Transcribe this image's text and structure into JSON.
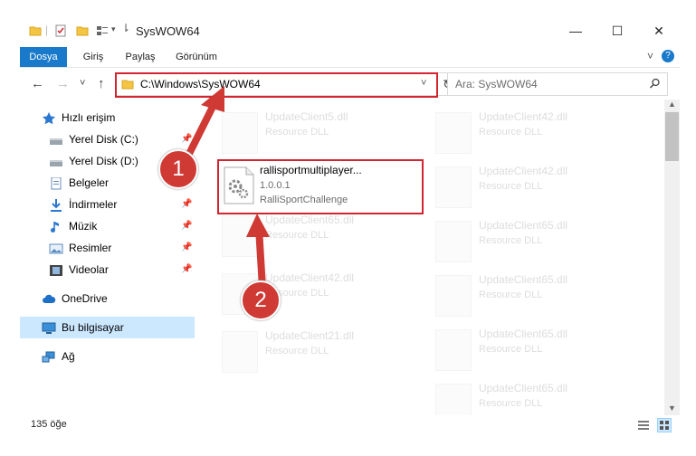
{
  "window": {
    "title": "SysWOW64",
    "minimize": "—",
    "maximize": "☐",
    "close": "✕"
  },
  "ribbon": {
    "tabs": [
      "Dosya",
      "Giriş",
      "Paylaş",
      "Görünüm"
    ],
    "expand": "˅",
    "help": "?"
  },
  "address": {
    "back": "←",
    "forward": "→",
    "recent": "˅",
    "up": "↑",
    "path": "C:\\Windows\\SysWOW64",
    "dropdown": "˅",
    "refresh": "↻",
    "search_placeholder": "Ara: SysWOW64",
    "search_icon": "magnifier-icon"
  },
  "sidebar": {
    "items": [
      {
        "label": "Hızlı erişim",
        "icon": "star-icon"
      },
      {
        "label": "Yerel Disk (C:)",
        "icon": "drive-icon",
        "pinned": true
      },
      {
        "label": "Yerel Disk (D:)",
        "icon": "drive-icon",
        "pinned": true
      },
      {
        "label": "Belgeler",
        "icon": "documents-icon",
        "pinned": true
      },
      {
        "label": "İndirmeler",
        "icon": "download-icon",
        "pinned": true
      },
      {
        "label": "Müzik",
        "icon": "music-icon",
        "pinned": true
      },
      {
        "label": "Resimler",
        "icon": "pictures-icon",
        "pinned": true
      },
      {
        "label": "Videolar",
        "icon": "video-icon",
        "pinned": true
      },
      {
        "label": "OneDrive",
        "icon": "cloud-icon"
      },
      {
        "label": "Bu bilgisayar",
        "icon": "computer-icon",
        "selected": true
      },
      {
        "label": "Ağ",
        "icon": "network-icon"
      }
    ],
    "pin_glyph": "📌"
  },
  "files": {
    "left_column": [
      {
        "name": "UpdateClient5.dll",
        "desc": "Resource DLL"
      },
      {
        "name": "UpdateClient65.dll",
        "desc": "Resource DLL"
      },
      {
        "name": "UpdateClient42.dll",
        "desc": "Resource DLL"
      },
      {
        "name": "UpdateClient21.dll",
        "desc": "Resource DLL"
      }
    ],
    "right_column": [
      {
        "name": "UpdateClient42.dll",
        "desc": "Resource DLL"
      },
      {
        "name": "UpdateClient42.dll",
        "desc": "Resource DLL"
      },
      {
        "name": "UpdateClient65.dll",
        "desc": "Resource DLL"
      },
      {
        "name": "UpdateClient65.dll",
        "desc": "Resource DLL"
      },
      {
        "name": "UpdateClient65.dll",
        "desc": "Resource DLL"
      },
      {
        "name": "UpdateClient65.dll",
        "desc": "Resource DLL"
      }
    ],
    "highlighted": {
      "name": "rallisportmultiplayer...",
      "version": "1.0.0.1",
      "description": "RalliSportChallenge"
    }
  },
  "callouts": {
    "one": "1",
    "two": "2"
  },
  "status": {
    "item_count": "135 öğe"
  },
  "colors": {
    "accent": "#1979ca",
    "highlight_border": "#d2252f",
    "badge": "#cf3a34",
    "selected_bg": "#cce8ff"
  }
}
